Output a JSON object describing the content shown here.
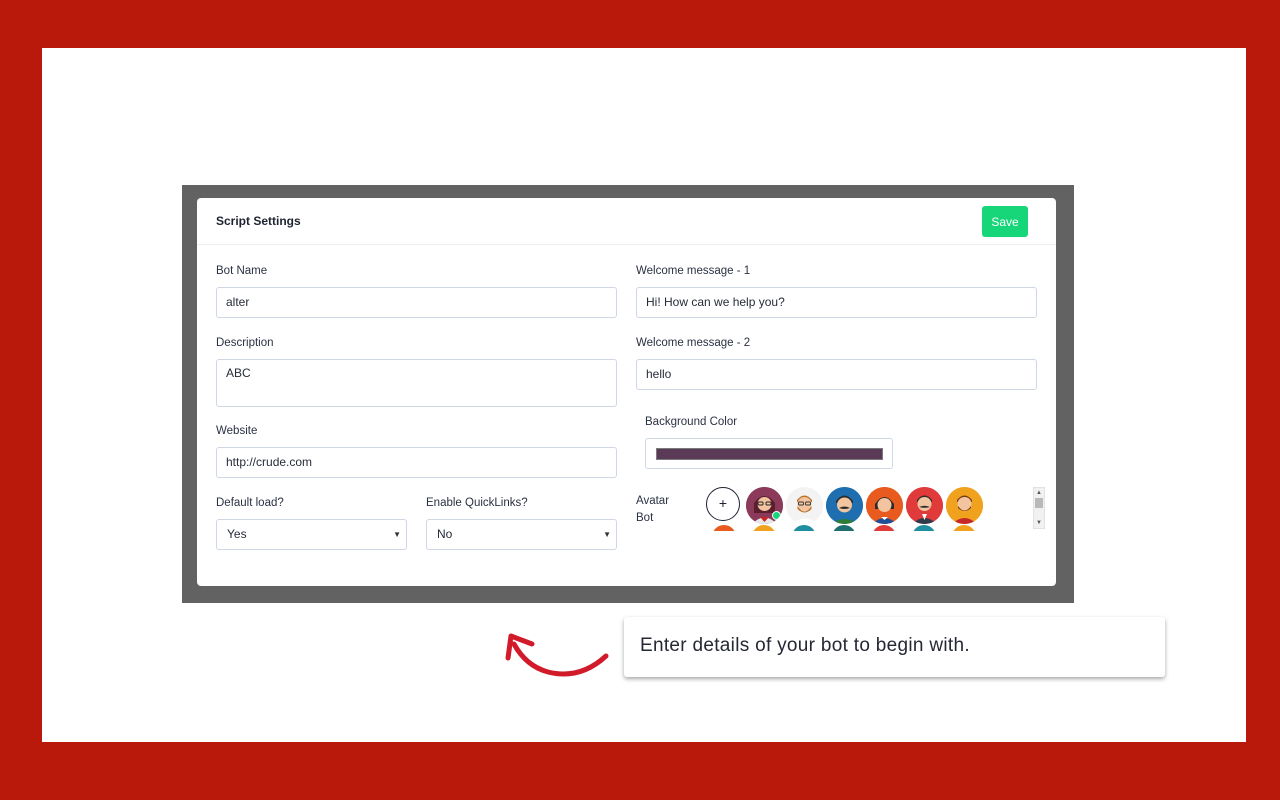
{
  "colors": {
    "page_background": "#b8190a",
    "accent_save": "#17d67a",
    "arrow": "#d21b2a",
    "background_color_value": "#5a3a56"
  },
  "card": {
    "title": "Script Settings",
    "save_label": "Save"
  },
  "form": {
    "bot_name": {
      "label": "Bot Name",
      "value": "alter"
    },
    "description": {
      "label": "Description",
      "value": "ABC"
    },
    "website": {
      "label": "Website",
      "value": "http://crude.com"
    },
    "default_load": {
      "label": "Default load?",
      "value": "Yes"
    },
    "enable_quicklinks": {
      "label": "Enable QuickLinks?",
      "value": "No"
    },
    "welcome_1": {
      "label": "Welcome message - 1",
      "value": "Hi! How can we help you?"
    },
    "welcome_2": {
      "label": "Welcome message - 2",
      "value": "hello"
    },
    "background_color": {
      "label": "Background Color"
    },
    "avatar": {
      "label_line1": "Avatar",
      "label_line2": "Bot",
      "add_label": "+",
      "avatars": [
        {
          "name": "woman-glasses",
          "bg": "#8c3a5a",
          "selected": true
        },
        {
          "name": "man-beard",
          "bg": "#f3f3f3"
        },
        {
          "name": "man-mustache",
          "bg": "#1f6fb0"
        },
        {
          "name": "woman-dark-hair",
          "bg": "#e85a1e"
        },
        {
          "name": "man-suit",
          "bg": "#e03a3a"
        },
        {
          "name": "man-red-shirt",
          "bg": "#f0a21e"
        }
      ]
    }
  },
  "callout": {
    "text": "Enter details of your bot to begin with."
  }
}
